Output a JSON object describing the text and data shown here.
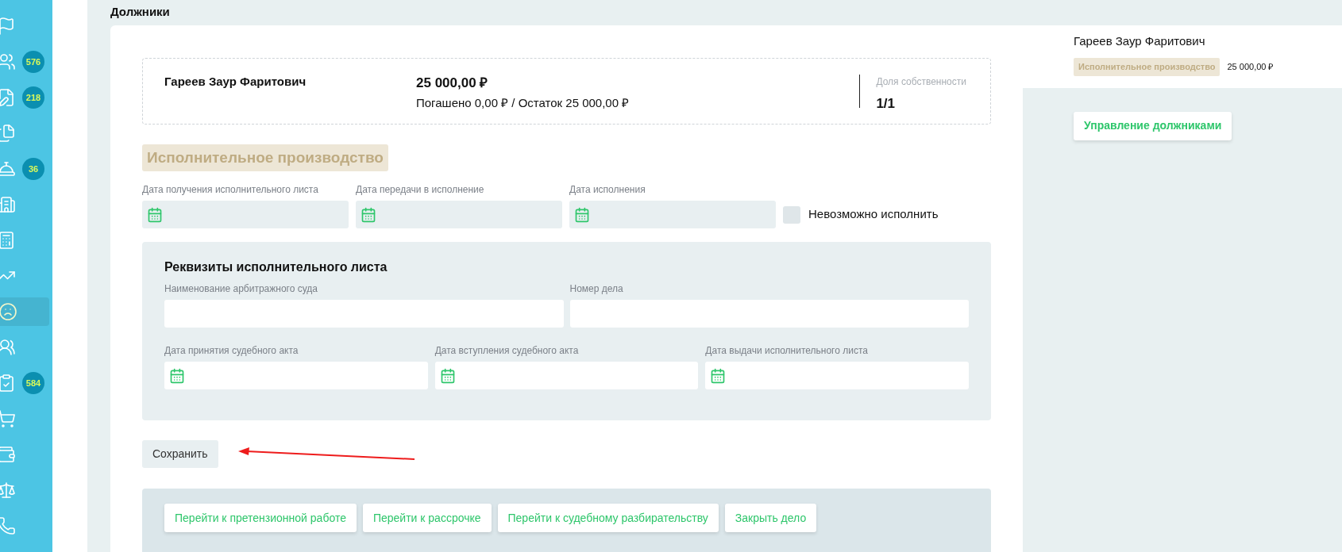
{
  "sidebar": {
    "items": [
      {
        "selected": false
      },
      {
        "badge": "576",
        "selected": false
      },
      {
        "badge": "218",
        "selected": false
      },
      {
        "selected": false
      },
      {
        "badge": "36",
        "selected": false
      },
      {
        "selected": false
      },
      {
        "selected": false
      },
      {
        "selected": false
      },
      {
        "selected": true
      },
      {
        "selected": false
      },
      {
        "badge": "584",
        "selected": false
      },
      {
        "selected": false
      },
      {
        "selected": false
      },
      {
        "selected": false
      },
      {
        "selected": false
      }
    ]
  },
  "page_title": "Должники",
  "debtor_card": {
    "name": "Гареев Заур Фаритович",
    "amount": "25 000,00 ₽",
    "paid_line": "Погашено 0,00 ₽ / Остаток 25 000,00 ₽",
    "share_label": "Доля собственности",
    "share_value": "1/1"
  },
  "stage_title": "Исполнительное производство",
  "date_fields": [
    {
      "label": "Дата получения исполнительного листа"
    },
    {
      "label": "Дата передачи в исполнение"
    },
    {
      "label": "Дата исполнения"
    }
  ],
  "impossible": {
    "label": "Невозможно исполнить",
    "checked": false
  },
  "requisites": {
    "title": "Реквизиты исполнительного листа",
    "text_fields": [
      {
        "label": "Наименование арбитражного суда"
      },
      {
        "label": "Номер дела"
      }
    ],
    "date_fields": [
      {
        "label": "Дата принятия судебного акта"
      },
      {
        "label": "Дата вступления судебного акта"
      },
      {
        "label": "Дата выдачи исполнительного листа"
      }
    ]
  },
  "save_button": "Сохранить",
  "actions": [
    "Перейти к претензионной работе",
    "Перейти к рассрочке",
    "Перейти к судебному разбирательству",
    "Закрыть дело"
  ],
  "side_panel": {
    "name": "Гареев Заур Фаритович",
    "stage_tag": "Исполнительное производство",
    "amount": "25 000,00 ₽",
    "manage_button": "Управление должниками"
  }
}
